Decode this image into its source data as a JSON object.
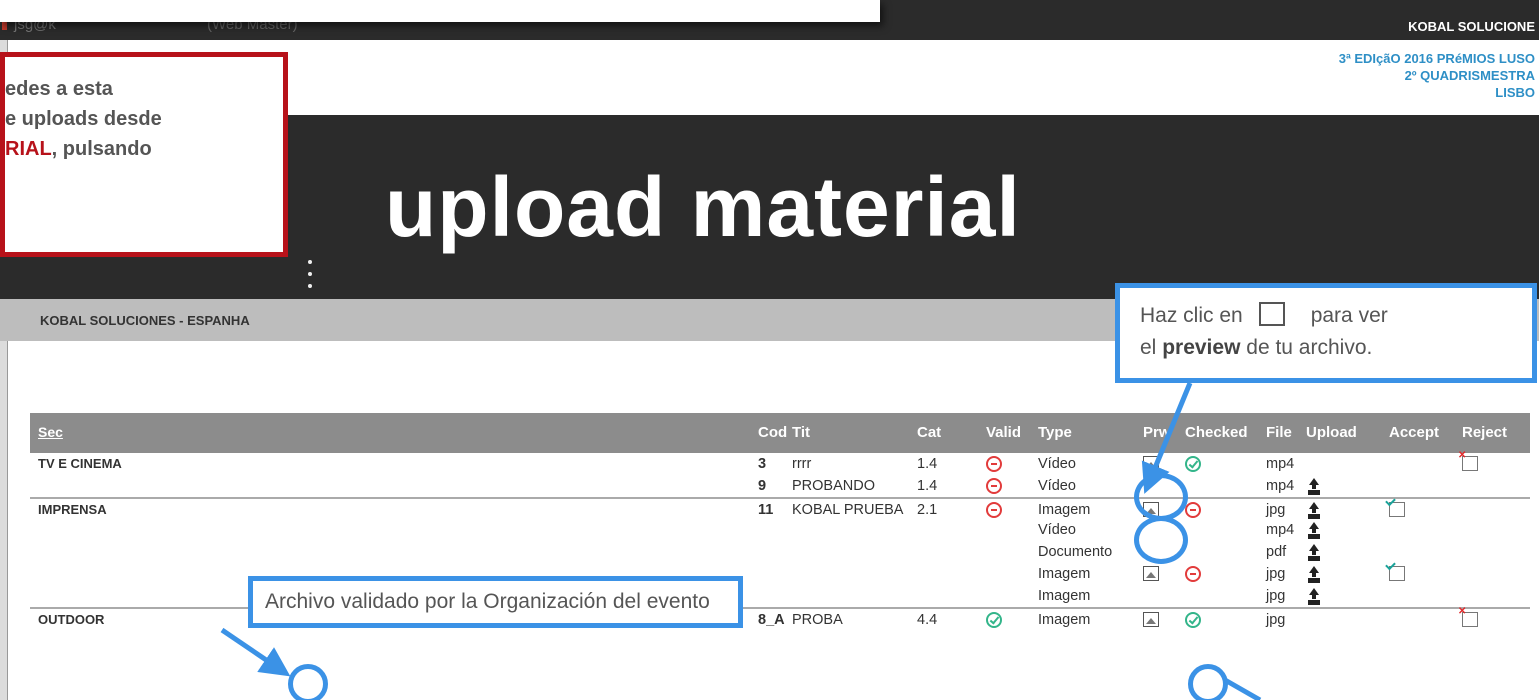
{
  "topbar": {
    "user": "jsg@k",
    "role": "(Web Master)",
    "company": "KOBAL SOLUCIONE"
  },
  "event": {
    "line1": "3ª EDIçãO 2016 PRéMIOS LUSO",
    "line2": "2º QUADRISMESTRA",
    "line3": "LISBO"
  },
  "banner": {
    "title": "upload material"
  },
  "company_bar": {
    "label": "KOBAL SOLUCIONES - ESPANHA"
  },
  "callout_instructions": {
    "line1": "edes a esta",
    "line2": "e uploads desde",
    "line3_highlight": "RIAL",
    "line3_rest": ", pulsando"
  },
  "callout_preview": {
    "text_before": "Haz clic en",
    "text_after": "para ver",
    "line2_before": "el",
    "line2_bold": "preview",
    "line2_after": "de tu archivo."
  },
  "callout_valid": {
    "text": "Archivo validado por la Organización del evento"
  },
  "table": {
    "headers": {
      "sec": "Sec",
      "cod": "Cod",
      "tit": "Tit",
      "cat": "Cat",
      "valid": "Valid",
      "type": "Type",
      "prw": "Prw",
      "checked": "Checked",
      "file": "File",
      "upload": "Upload",
      "accept": "Accept",
      "reject": "Reject"
    },
    "rows": [
      {
        "sec": "TV E CINEMA",
        "cod": "3",
        "tit": "rrrr",
        "cat": "1.4",
        "valid": "minus",
        "type": "Vídeo",
        "prw": "image-icon",
        "checked": "check",
        "file": "mp4",
        "upload": "",
        "accept": "",
        "reject": "reject-icon"
      },
      {
        "sec": "",
        "cod": "9",
        "tit": "PROBANDO",
        "cat": "1.4",
        "valid": "minus",
        "type": "Vídeo",
        "prw": "",
        "checked": "",
        "file": "mp4",
        "upload": "upload-icon",
        "accept": "",
        "reject": ""
      },
      {
        "sec": "IMPRENSA",
        "cod": "11",
        "tit": "KOBAL PRUEBA",
        "cat": "2.1",
        "valid": "minus",
        "type": "Imagem",
        "prw": "image-icon",
        "checked": "minus",
        "file": "jpg",
        "upload": "upload-icon",
        "accept": "accept-icon",
        "reject": ""
      },
      {
        "sec": "",
        "cod": "",
        "tit": "",
        "cat": "",
        "valid": "",
        "type": "Vídeo",
        "prw": "",
        "checked": "",
        "file": "mp4",
        "upload": "upload-icon",
        "accept": "",
        "reject": ""
      },
      {
        "sec": "",
        "cod": "",
        "tit": "",
        "cat": "",
        "valid": "",
        "type": "Documento",
        "prw": "",
        "checked": "",
        "file": "pdf",
        "upload": "upload-icon",
        "accept": "",
        "reject": ""
      },
      {
        "sec": "",
        "cod": "",
        "tit": "",
        "cat": "",
        "valid": "",
        "type": "Imagem",
        "prw": "image-icon",
        "checked": "minus",
        "file": "jpg",
        "upload": "upload-icon",
        "accept": "accept-icon",
        "reject": ""
      },
      {
        "sec": "",
        "cod": "",
        "tit": "",
        "cat": "",
        "valid": "",
        "type": "Imagem",
        "prw": "",
        "checked": "",
        "file": "jpg",
        "upload": "upload-icon",
        "accept": "",
        "reject": ""
      },
      {
        "sec": "OUTDOOR",
        "cod": "8_A",
        "tit": "PROBA",
        "cat": "4.4",
        "valid": "check",
        "type": "Imagem",
        "prw": "image-icon",
        "checked": "check",
        "file": "jpg",
        "upload": "",
        "accept": "",
        "reject": "reject-icon"
      }
    ]
  },
  "colors": {
    "banner": "#2b2b2b",
    "callout_red": "#b7121a",
    "callout_blue": "#3b92e6",
    "event_blue": "#2e8fc6",
    "invalid_red": "#e23b3b",
    "valid_green": "#33b58a"
  }
}
